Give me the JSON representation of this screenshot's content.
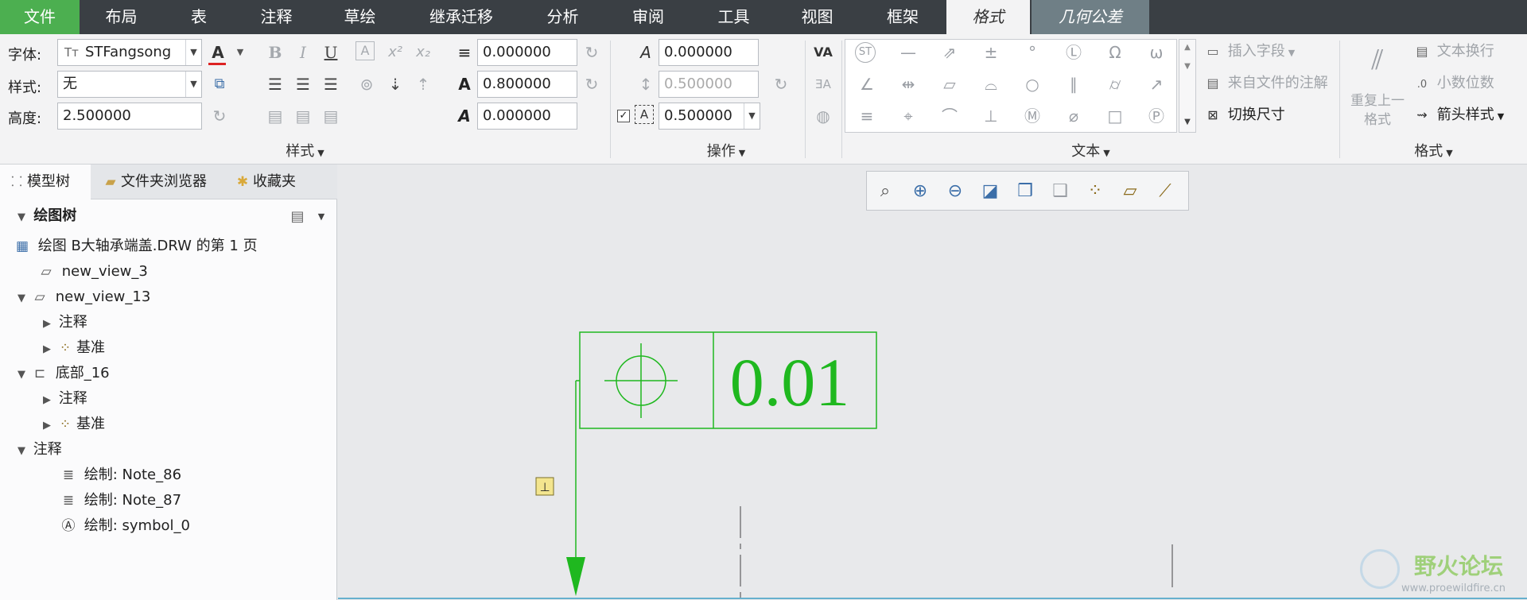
{
  "tabs": [
    {
      "label": "文件",
      "name": "file"
    },
    {
      "label": "布局",
      "name": "layout"
    },
    {
      "label": "表",
      "name": "table"
    },
    {
      "label": "注释",
      "name": "annotate"
    },
    {
      "label": "草绘",
      "name": "sketch"
    },
    {
      "label": "继承迁移",
      "name": "legacy-migration"
    },
    {
      "label": "分析",
      "name": "analysis"
    },
    {
      "label": "审阅",
      "name": "review"
    },
    {
      "label": "工具",
      "name": "tools"
    },
    {
      "label": "视图",
      "name": "view"
    },
    {
      "label": "框架",
      "name": "framework"
    },
    {
      "label": "格式",
      "name": "format"
    },
    {
      "label": "几何公差",
      "name": "geometric-tolerance"
    }
  ],
  "ribbon": {
    "style": {
      "font_label": "字体:",
      "font_value": "STFangsong",
      "style_label": "样式:",
      "style_value": "无",
      "height_label": "高度:",
      "height_value": "2.500000",
      "group": "样式"
    },
    "numbers": {
      "line_thickness": "0.000000",
      "width_factor": "0.800000",
      "slant_angle": "0.000000"
    },
    "operations": {
      "angle": "0.000000",
      "line_spacing": "0.500000",
      "frame_offset": "0.500000",
      "group": "操作"
    },
    "text": {
      "insert_field": "插入字段",
      "from_file": "来自文件的注解",
      "toggle_dim": "切换尺寸",
      "group": "文本"
    },
    "format": {
      "repeat_last": "重复上一\n格式",
      "text_wrap": "文本换行",
      "decimal_places": "小数位数",
      "arrow_style": "箭头样式",
      "group": "格式"
    }
  },
  "leftpanel": {
    "tabs": [
      "模型树",
      "文件夹浏览器",
      "收藏夹"
    ],
    "tree_title": "绘图树",
    "rows": [
      "绘图 B大轴承端盖.DRW 的第 1 页",
      "new_view_3",
      "new_view_13",
      "注释",
      "基准",
      "底部_16",
      "注释",
      "基准",
      "注释",
      "绘制: Note_86",
      "绘制: Note_87",
      "绘制: symbol_0"
    ]
  },
  "drawing": {
    "tolerance_value": "0.01",
    "datum_tag": "⊥"
  },
  "colors": {
    "file_tab": "#4caf50",
    "tabbar": "#3a3f44",
    "annotation_green": "#1fb81f",
    "view_icon_blue": "#3b6ea8"
  },
  "watermark": {
    "title": "野火论坛",
    "url": "www.proewildfire.cn"
  }
}
